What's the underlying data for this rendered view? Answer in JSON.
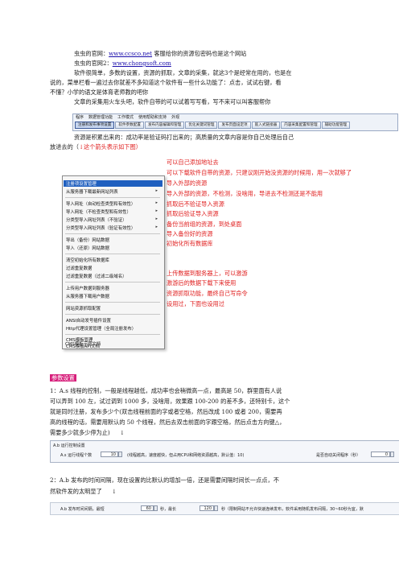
{
  "intro": {
    "line1_prefix": "虫虫的官网：",
    "line1_link": "www.ccsco.net",
    "line1_suffix": "    客服给你的资源包密码也是这个网站",
    "line2_prefix": "虫虫的官网2：",
    "line2_link": "www.chongsoft.com",
    "line3": "软件很简单，多数的设置，资源的抓取，文章的采集，就这3个是经常在用的，也是在",
    "line4": "说的，菜单栏看一遍过去你就差不多知道这个软件有一些什么功能了：点击，试试右键，看",
    "line5": "不懂？小学的语文是体育老师教的吧你",
    "line6": "文章的采集用火车头吧，软件自带的可以试着写写看，写不来可以叫客服帮你",
    "line7": "资源是积累出来的：成功率是验证码打出来的；高质量的文章内容是你自己处理后自己",
    "line8_prefix": "放进去的（",
    "line8_red": "↓这个箭头表示如下图）"
  },
  "menubar": {
    "top_menu": [
      "程序",
      "数据管理功能",
      "工作模式",
      "使用帮助和支持",
      "外观"
    ],
    "tabs": [
      "注册和发布事项设置",
      "软件参数配置",
      "发布内容编辑和管理",
      "优化关键词管理",
      "发布页面设定项",
      "嵌入式链接器",
      "内容采集配置和管理",
      "辅助功能管理"
    ]
  },
  "context_menu": {
    "items": [
      {
        "label": "注册项设置管理",
        "selected": true,
        "arrow": false
      },
      {
        "label": "从服务器下载最新网站列表",
        "selected": false,
        "arrow": true
      },
      {
        "label": "导入网址（自动检查类型和有效性）",
        "selected": false,
        "arrow": true
      },
      {
        "label": "导入网址（不检查类型和有效性）",
        "selected": false,
        "arrow": true
      },
      {
        "label": "分类型导入网址列表（不验证）",
        "selected": false,
        "arrow": true
      },
      {
        "label": "分类型导入网址列表（验证有效性）",
        "selected": false,
        "arrow": true
      },
      {
        "label": "导出（备份）网站数据",
        "selected": false,
        "arrow": false
      },
      {
        "label": "导入（还原）网站数据",
        "selected": false,
        "arrow": false
      },
      {
        "label": "清空初始化所有数据库",
        "selected": false,
        "arrow": false
      },
      {
        "label": "过滤重复数据",
        "selected": false,
        "arrow": false
      },
      {
        "label": "过滤重复数据（过滤二级域名）",
        "selected": false,
        "arrow": false
      },
      {
        "label": "上传用户数据到服务器",
        "selected": false,
        "arrow": false
      },
      {
        "label": "从服务器下载用户数据",
        "selected": false,
        "arrow": false
      },
      {
        "label": "网站资源抓取配置",
        "selected": false,
        "arrow": false
      },
      {
        "label": "ANSI自动发号插件设置",
        "selected": false,
        "arrow": false
      },
      {
        "label": "Http代理设置管理（全局注册发布）",
        "selected": false,
        "arrow": false
      },
      {
        "label": "CMS模板管理",
        "selected": false,
        "arrow": false
      },
      {
        "label": "CMS模板API文档",
        "selected": false,
        "arrow": false
      },
      {
        "label": "CMS模板示例文档",
        "selected": false,
        "arrow": false
      }
    ]
  },
  "annotations": [
    "可以自己添加地址去",
    "可以下载软件自带的资源，只建议刚开始没资源的时候用，用一次就够了",
    "导入外部的资源",
    "导入外部的资源，不检测，没啥用，导进去不检测还是不能用",
    "抓取后不验证导入资源",
    "抓取后验证导入资源",
    "备份当前组的资源，到处桌面",
    "导入备份好的资源",
    "初始化所有数据库",
    "上传数据到服务器上，可以激游",
    "激游后的数据下载下来使用",
    "资源抓取功能，最终自己写命令",
    "设用过，下面也设用过"
  ],
  "section": {
    "title": "参数设置",
    "p1_l1": "1：A.s 线程的控制，一般是线程越低，成功率也会稍微高一点，最高是 50，群里面有人说",
    "p1_l2": "可以弄到 100 左，试过调到 1000 多，没啥用，效果跟 100-200 的差不多，还特别卡，这个",
    "p1_l3": "就是同时注册，发布多少个(双击线程前面的字或者空格，然后改成 100 或者 200，需要再",
    "p1_l4": "高的线程的话，需要用默认的 50 个线程，然后去双击前面的字跟空格，然后点击方向键△，",
    "p1_l5": "需要多少就多少停为止)",
    "p1_arrow": "↓",
    "p2_l1": "2：A.b 发布的时间间隔，现在设置的比默认的增加一倍，还是需要间隔时间长一点点，不",
    "p2_l2": "然软件发的太明显了",
    "p2_arrow": "↓"
  },
  "panel1": {
    "header": "A.b 运行控制设置",
    "label": "A.s 运行线程个数",
    "value": "10",
    "note": "(线程越高，速度越快，但占用CPU和网络资源越高，默认值：10)",
    "checkbox_label": "是否自动关闭程序（秒）",
    "value2": "0"
  },
  "panel2": {
    "label": "A.b 发布时间间隔，最短",
    "min_value": "60",
    "sec1": "秒，最长",
    "max_value": "120",
    "note": "秒（限制网站不允许快速连续发布，软件采用随机发布间隔，30~60秒为宜，默"
  }
}
